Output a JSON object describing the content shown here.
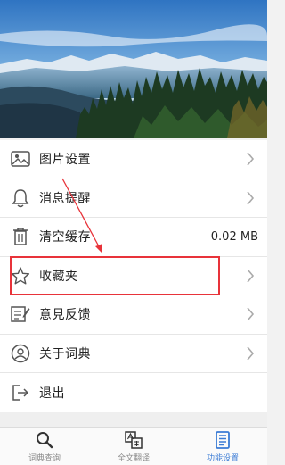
{
  "menu": {
    "items": [
      {
        "label": "图片设置",
        "icon": "image-icon"
      },
      {
        "label": "消息提醒",
        "icon": "bell-icon"
      },
      {
        "label": "清空缓存",
        "icon": "trash-icon",
        "value": "0.02 MB"
      },
      {
        "label": "收藏夹",
        "icon": "star-icon"
      },
      {
        "label": "意見反馈",
        "icon": "feedback-icon"
      },
      {
        "label": "关于词典",
        "icon": "user-circle-icon"
      },
      {
        "label": "退出",
        "icon": "logout-icon"
      }
    ]
  },
  "tabbar": {
    "tabs": [
      {
        "label": "词典查询",
        "icon": "search-icon",
        "active": false
      },
      {
        "label": "全文翻译",
        "icon": "translate-icon",
        "active": false
      },
      {
        "label": "功能设置",
        "icon": "book-icon",
        "active": true
      }
    ]
  },
  "colors": {
    "highlight": "#e8333a",
    "active_tab": "#3a7bd5",
    "icon": "#555555"
  }
}
